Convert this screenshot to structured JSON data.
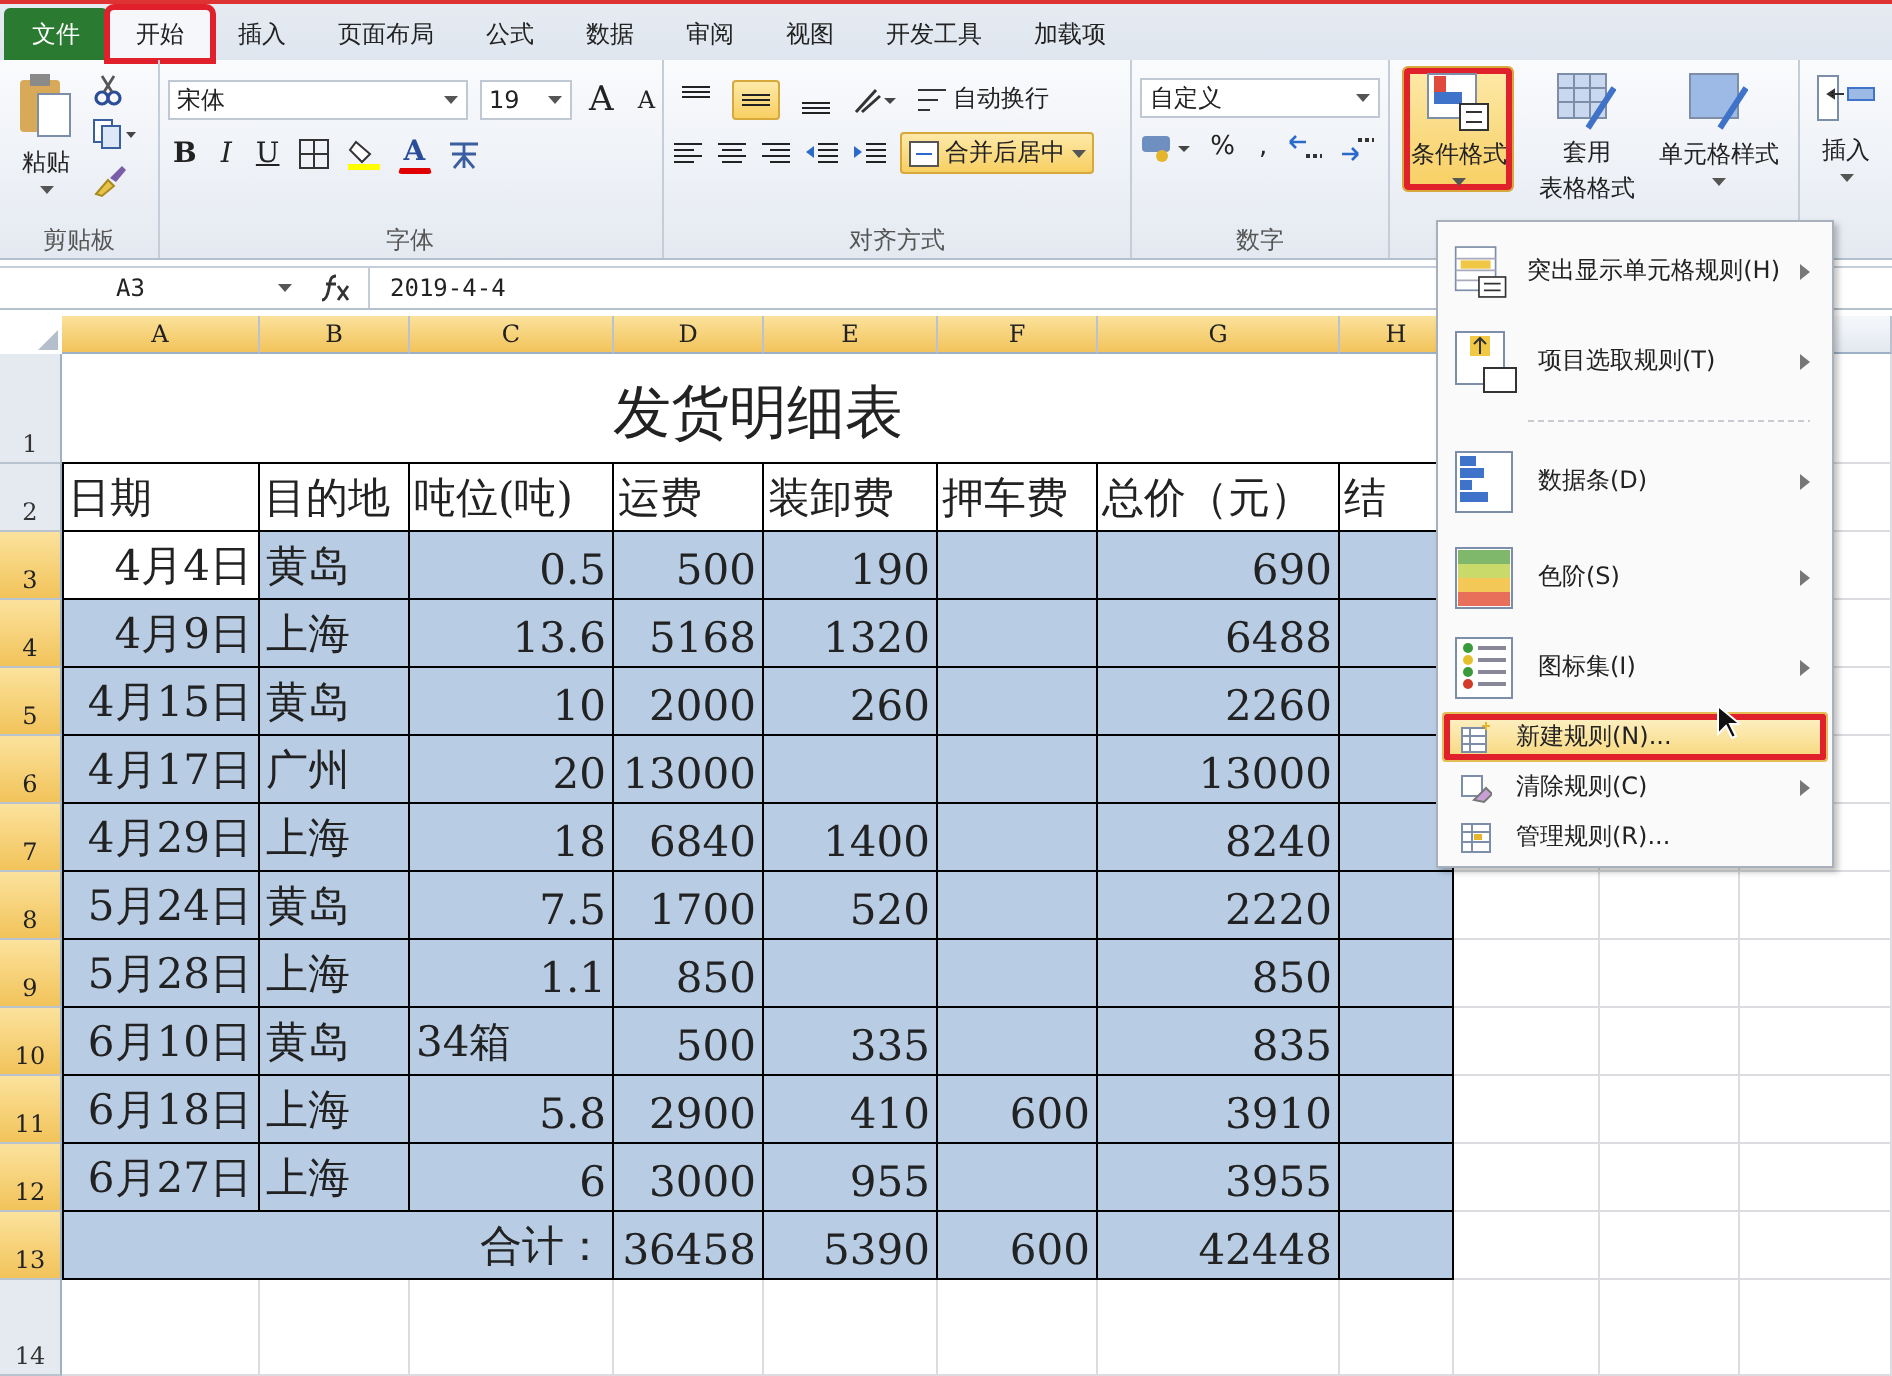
{
  "ribbon": {
    "tabs": [
      {
        "label": "文件",
        "kind": "file",
        "selected": false,
        "annotated": false
      },
      {
        "label": "开始",
        "kind": "tab",
        "selected": true,
        "annotated": true
      },
      {
        "label": "插入",
        "kind": "tab",
        "selected": false,
        "annotated": false
      },
      {
        "label": "页面布局",
        "kind": "tab",
        "selected": false,
        "annotated": false
      },
      {
        "label": "公式",
        "kind": "tab",
        "selected": false,
        "annotated": false
      },
      {
        "label": "数据",
        "kind": "tab",
        "selected": false,
        "annotated": false
      },
      {
        "label": "审阅",
        "kind": "tab",
        "selected": false,
        "annotated": false
      },
      {
        "label": "视图",
        "kind": "tab",
        "selected": false,
        "annotated": false
      },
      {
        "label": "开发工具",
        "kind": "tab",
        "selected": false,
        "annotated": false
      },
      {
        "label": "加载项",
        "kind": "tab",
        "selected": false,
        "annotated": false
      }
    ],
    "clipboard": {
      "label": "剪贴板",
      "paste": "粘贴"
    },
    "font": {
      "label": "字体",
      "font_name": "宋体",
      "font_size": "19",
      "grow": "A",
      "shrink": "A",
      "bold": "B",
      "italic": "I",
      "underline": "U",
      "font_color": "A"
    },
    "alignment": {
      "label": "对齐方式",
      "vertical": [
        {
          "kind": "top",
          "on": false
        },
        {
          "kind": "middle",
          "on": true
        },
        {
          "kind": "bottom",
          "on": false
        }
      ],
      "wrap": "自动换行",
      "merge": "合并后居中",
      "merge_on": true
    },
    "number": {
      "label": "数字",
      "format": "自定义",
      "percent": "%",
      "comma": ","
    },
    "styles": {
      "conditional": "条件格式",
      "conditional_open": true,
      "annotated": true,
      "table": [
        "套用",
        "表格格式"
      ],
      "cell_styles": "单元格样式"
    },
    "cells": {
      "insert": "插入"
    }
  },
  "formula_bar": {
    "name_box": "A3",
    "formula": "2019-4-4"
  },
  "sheet": {
    "columns": [
      {
        "label": "A",
        "selected": true
      },
      {
        "label": "B",
        "selected": true
      },
      {
        "label": "C",
        "selected": true
      },
      {
        "label": "D",
        "selected": true
      },
      {
        "label": "E",
        "selected": true
      },
      {
        "label": "F",
        "selected": true
      },
      {
        "label": "G",
        "selected": true
      },
      {
        "label": "H",
        "selected": true
      }
    ],
    "title": {
      "row": "1",
      "text": "发货明细表"
    },
    "header": {
      "row": "2",
      "cells": [
        "日期",
        "目的地",
        "吨位(吨)",
        "运费",
        "装卸费",
        "押车费",
        "总价（元）",
        "结"
      ]
    },
    "rows": [
      {
        "row": "3",
        "selected": true,
        "cells": [
          {
            "v": "4月4日",
            "active": true
          },
          "黄岛",
          "0.5",
          "500",
          "190",
          "",
          "690",
          ""
        ]
      },
      {
        "row": "4",
        "selected": true,
        "cells": [
          "4月9日",
          "上海",
          "13.6",
          "5168",
          "1320",
          "",
          "6488",
          ""
        ]
      },
      {
        "row": "5",
        "selected": true,
        "cells": [
          "4月15日",
          "黄岛",
          "10",
          "2000",
          "260",
          "",
          "2260",
          ""
        ]
      },
      {
        "row": "6",
        "selected": true,
        "cells": [
          "4月17日",
          "广州",
          "20",
          "13000",
          "",
          "",
          "13000",
          ""
        ]
      },
      {
        "row": "7",
        "selected": true,
        "cells": [
          "4月29日",
          "上海",
          "18",
          "6840",
          "1400",
          "",
          "8240",
          ""
        ]
      },
      {
        "row": "8",
        "selected": true,
        "cells": [
          "5月24日",
          "黄岛",
          "7.5",
          "1700",
          "520",
          "",
          "2220",
          ""
        ]
      },
      {
        "row": "9",
        "selected": true,
        "cells": [
          "5月28日",
          "上海",
          "1.1",
          "850",
          "",
          "",
          "850",
          ""
        ]
      },
      {
        "row": "10",
        "selected": true,
        "cells": [
          "6月10日",
          "黄岛",
          {
            "v": "34箱",
            "left_aligned": true
          },
          "500",
          "335",
          "",
          "835",
          ""
        ]
      },
      {
        "row": "11",
        "selected": true,
        "cells": [
          "6月18日",
          "上海",
          "5.8",
          "2900",
          "410",
          "600",
          "3910",
          ""
        ]
      },
      {
        "row": "12",
        "selected": true,
        "cells": [
          "6月27日",
          "上海",
          "6",
          "3000",
          "955",
          "",
          "3955",
          ""
        ]
      }
    ],
    "total": {
      "row": "13",
      "selected": true,
      "label": "合计：",
      "cells": [
        "36458",
        "5390",
        "600",
        "42448",
        ""
      ]
    },
    "empty_rows": [
      {
        "row": "14",
        "selected": false
      }
    ]
  },
  "menu": {
    "items": [
      {
        "label": "突出显示单元格规则(H)",
        "kind": "highlight",
        "submenu": true,
        "separator_before": false,
        "selected": false,
        "annotated": false
      },
      {
        "label": "项目选取规则(T)",
        "kind": "top10",
        "submenu": true,
        "separator_before": false,
        "selected": false,
        "annotated": false
      },
      {
        "label": "数据条(D)",
        "kind": "databar",
        "submenu": true,
        "separator_before": true,
        "selected": false,
        "annotated": false
      },
      {
        "label": "色阶(S)",
        "kind": "colorscale",
        "submenu": true,
        "separator_before": false,
        "selected": false,
        "annotated": false
      },
      {
        "label": "图标集(I)",
        "kind": "iconset",
        "submenu": true,
        "separator_before": false,
        "selected": false,
        "annotated": false
      },
      {
        "label": "新建规则(N)...",
        "kind": "new",
        "submenu": false,
        "separator_before": false,
        "selected": true,
        "annotated": true
      },
      {
        "label": "清除规则(C)",
        "kind": "clear",
        "submenu": true,
        "separator_before": false,
        "selected": false,
        "annotated": false
      },
      {
        "label": "管理规则(R)...",
        "kind": "manage",
        "submenu": false,
        "separator_before": false,
        "selected": false,
        "annotated": false
      }
    ]
  }
}
